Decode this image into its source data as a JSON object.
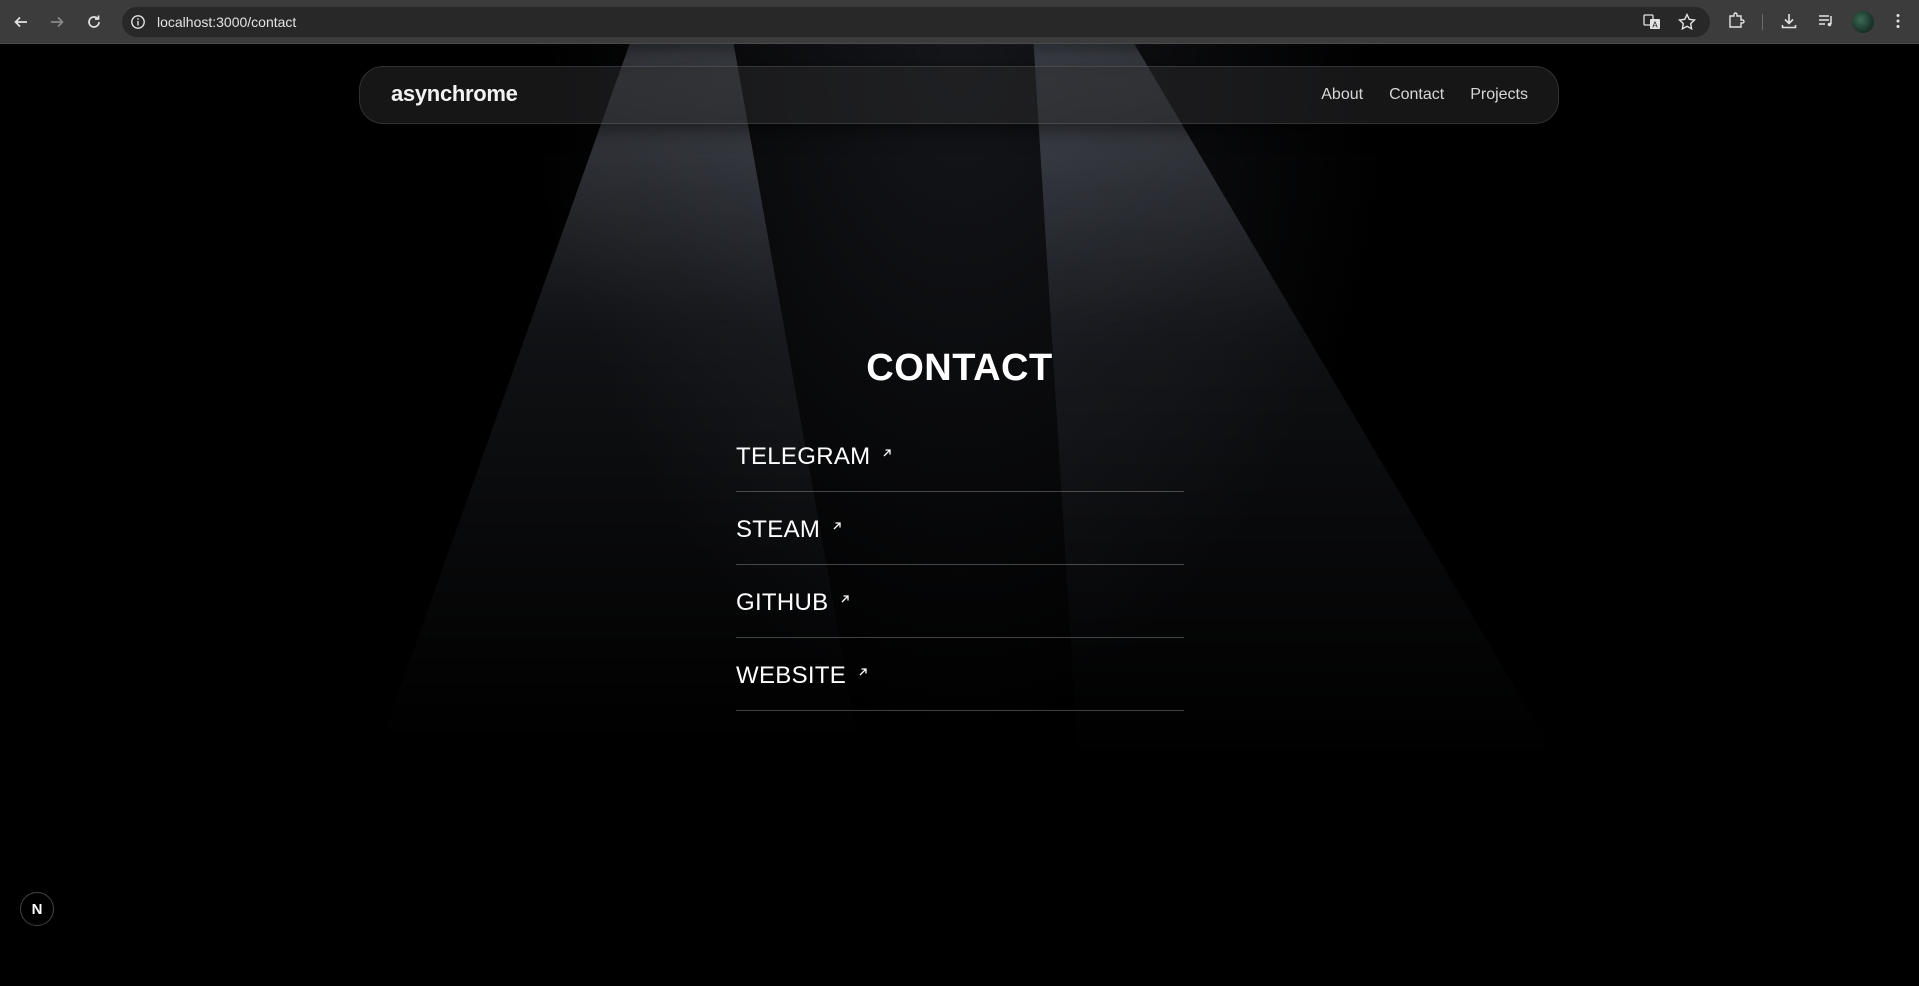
{
  "browser": {
    "url": "localhost:3000/contact"
  },
  "site": {
    "brand": "asynchrome",
    "nav": [
      "About",
      "Contact",
      "Projects"
    ]
  },
  "page": {
    "title": "CONTACT",
    "links": [
      "TELEGRAM",
      "STEAM",
      "GITHUB",
      "WEBSITE"
    ]
  },
  "dev_badge": "N",
  "icons": {
    "back": "arrow-left-icon",
    "forward": "arrow-right-icon",
    "reload": "reload-icon",
    "site_info": "info-icon",
    "translate": "translate-icon",
    "bookmark": "star-icon",
    "extensions": "puzzle-icon",
    "downloads": "download-icon",
    "media": "media-control-icon",
    "menu": "kebab-menu-icon",
    "external_link": "arrow-up-right-icon"
  }
}
